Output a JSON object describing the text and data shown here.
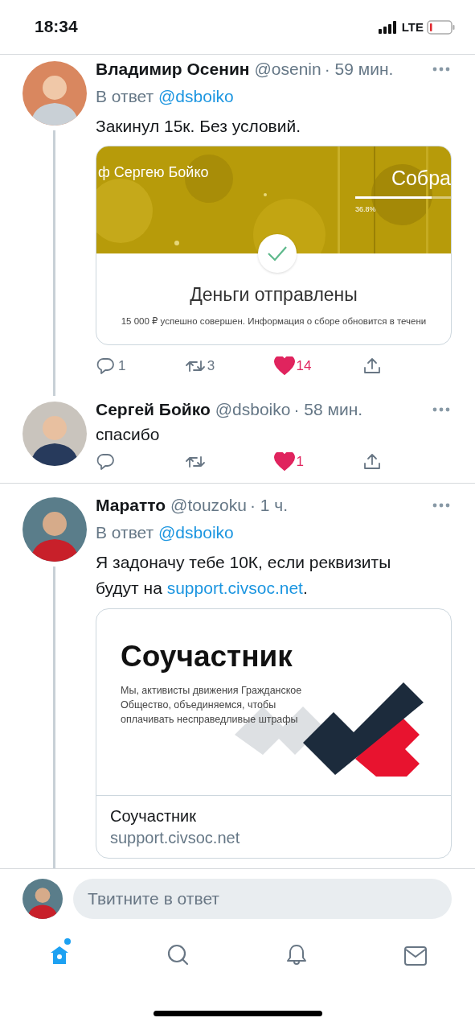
{
  "status_bar": {
    "time": "18:34",
    "network": "LTE"
  },
  "tweets": [
    {
      "name": "Владимир Осенин",
      "handle": "@osenin",
      "time": "· 59 мин.",
      "thread_line": true,
      "reply_to": {
        "label": "В ответ",
        "handle": "@dsboiko"
      },
      "text": [
        {
          "text": "Закинул 15к. Без условий."
        }
      ],
      "card": {
        "kind": "payment",
        "banner_title": "ф Сергею Бойко",
        "banner_heading": "Собра",
        "progress": {
          "level": 0.8,
          "reading": "36.8%"
        },
        "title": "Деньги отправлены",
        "message": "15 000 ₽ успешно совершен. Информация о сборе обновится в течени"
      },
      "actions": {
        "replies": "1",
        "retweets": "3",
        "likes": "14",
        "liked": true
      }
    },
    {
      "name": "Сергей Бойко",
      "handle": "@dsboiko",
      "time": "· 58 мин.",
      "thread_line": false,
      "text": [
        {
          "text": "спасибо"
        }
      ],
      "actions": {
        "likes": "1",
        "liked": true
      }
    },
    {
      "name": "Маратто",
      "handle": "@touzoku",
      "time": "· 1 ч.",
      "thread_line": true,
      "reply_to": {
        "label": "В ответ",
        "handle": "@dsboiko"
      },
      "text": [
        {
          "text": "Я задоначу тебе 10К, если реквизиты будут на "
        },
        {
          "text": "support.civsoc.net",
          "kind": "link"
        },
        {
          "text": "."
        }
      ],
      "card": {
        "kind": "link",
        "image": {
          "title": "Соучастник",
          "description": "Мы, активисты движения Гражданское Общество, объединяемся, чтобы оплачивать несправедливые штрафы"
        },
        "title": "Соучастник",
        "url": "support.civsoc.net"
      }
    }
  ],
  "reply_box": {
    "placeholder": "Твитните в ответ"
  },
  "nav": [
    {
      "kind": "home",
      "selected": true,
      "badge": true
    },
    {
      "kind": "search",
      "selected": false
    },
    {
      "kind": "notifications",
      "selected": false
    },
    {
      "kind": "messages",
      "selected": false
    }
  ]
}
